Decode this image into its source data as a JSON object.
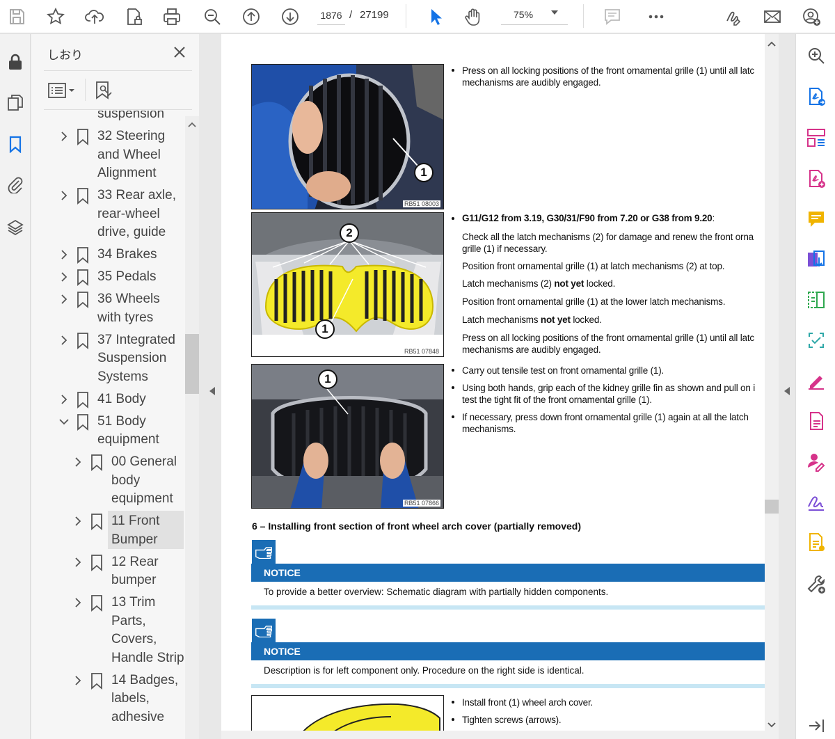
{
  "toolbar": {
    "current_page": "1876",
    "page_separator": "/",
    "total_pages": "27199",
    "zoom": "75%",
    "icons": [
      "save-icon",
      "star-icon",
      "upload-icon",
      "lock-file-icon",
      "print-icon",
      "zoom-out-icon",
      "page-up-icon",
      "page-down-icon",
      "pointer-icon",
      "hand-icon",
      "comment-icon",
      "more-icon",
      "sign-icon",
      "mail-icon",
      "account-icon"
    ]
  },
  "bookmarks": {
    "title": "しおり",
    "items": [
      {
        "label": "suspension",
        "level": 0,
        "expanded": null
      },
      {
        "label": "32 Steering\nand Wheel\nAlignment",
        "level": 0,
        "expanded": false
      },
      {
        "label": "33 Rear axle,\nrear-wheel\ndrive, guide",
        "level": 0,
        "expanded": false
      },
      {
        "label": "34 Brakes",
        "level": 0,
        "expanded": false
      },
      {
        "label": "35 Pedals",
        "level": 0,
        "expanded": false
      },
      {
        "label": "36 Wheels\nwith tyres",
        "level": 0,
        "expanded": false
      },
      {
        "label": "37 Integrated\nSuspension\nSystems",
        "level": 0,
        "expanded": false
      },
      {
        "label": "41 Body",
        "level": 0,
        "expanded": false
      },
      {
        "label": "51 Body\nequipment",
        "level": 0,
        "expanded": true
      },
      {
        "label": "00 General\nbody\nequipment",
        "level": 1,
        "expanded": false
      },
      {
        "label": "11 Front\nBumper",
        "level": 1,
        "expanded": false,
        "selected": true
      },
      {
        "label": "12 Rear\nbumper",
        "level": 1,
        "expanded": false
      },
      {
        "label": "13 Trim\nParts,\nCovers,\nHandle Strip",
        "level": 1,
        "expanded": false
      },
      {
        "label": "14 Badges,\nlabels,\nadhesive",
        "level": 1,
        "expanded": false
      }
    ]
  },
  "document": {
    "photos": [
      {
        "code": "RB51 08003",
        "callouts": [
          "1"
        ]
      },
      {
        "code": "RB51 07848",
        "callouts": [
          "2",
          "1"
        ]
      },
      {
        "code": "RB51 07866",
        "callouts": [
          "1"
        ]
      }
    ],
    "block1": [
      "Press on all locking positions of the front ornamental grille (1) until all latc",
      "mechanisms are audibly engaged."
    ],
    "block2_head_a": "G11/G12 from 3.19, G30/31/F90 from 7.20 or G38 from 9.20",
    "block2_head_b": ":",
    "block2_lines": [
      [
        "Check all the latch mechanisms (2) for damage and renew the front orna",
        "grille (1) if necessary."
      ],
      [
        "Position front ornamental grille (1) at latch mechanisms (2) at top."
      ],
      [
        "Latch mechanisms (2) ",
        "not yet",
        " locked."
      ],
      [
        "Position front ornamental grille (1) at the lower latch mechanisms."
      ],
      [
        "Latch mechanisms ",
        "not yet",
        " locked."
      ],
      [
        "Press on all locking positions of the front ornamental grille (1) until all latc",
        "mechanisms are audibly engaged."
      ]
    ],
    "block3": [
      [
        "Carry out tensile test on front ornamental grille (1)."
      ],
      [
        "Using both hands, grip each of the kidney grille fin as shown and pull on i",
        "test the tight fit of the front ornamental grille (1)."
      ],
      [
        "If necessary, press down front ornamental grille (1) again at all the latch",
        "mechanisms."
      ]
    ],
    "section_heading": "6 – Installing front section of front wheel arch cover (partially removed)",
    "notices": [
      {
        "title": "NOTICE",
        "body": "To provide a better overview: Schematic diagram with partially hidden components."
      },
      {
        "title": "NOTICE",
        "body": "Description is for left component only. Procedure on the right side is identical."
      }
    ],
    "block4": [
      "Install front (1) wheel arch cover.",
      "Tighten screws (arrows)."
    ]
  },
  "colors": {
    "accent": "#1a6db5",
    "notice_rule": "#c7e6f4",
    "grille_yellow": "#f4ea2a",
    "acrobat_pink": "#d6338a",
    "acrobat_blue": "#1473e6"
  }
}
